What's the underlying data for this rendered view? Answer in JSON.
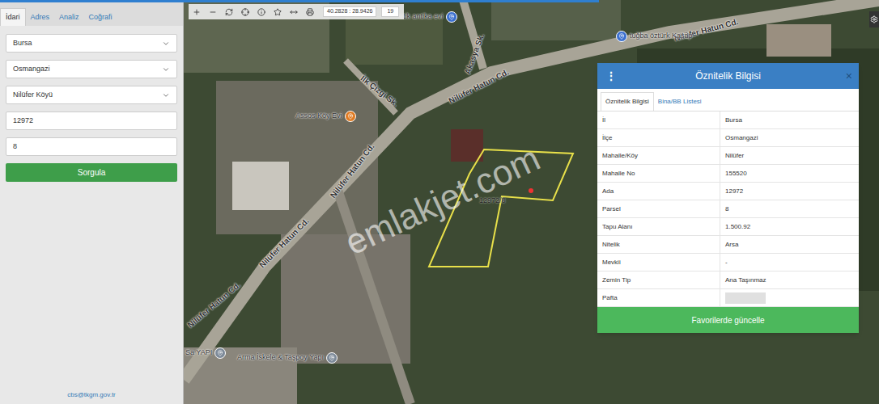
{
  "sidebar": {
    "tabs": [
      {
        "label": "İdari",
        "selected": true
      },
      {
        "label": "Adres",
        "selected": false
      },
      {
        "label": "Analiz",
        "selected": false
      },
      {
        "label": "Coğrafi",
        "selected": false
      }
    ],
    "fields": [
      {
        "kind": "select",
        "value": "Bursa"
      },
      {
        "kind": "select",
        "value": "Osmangazi"
      },
      {
        "kind": "select",
        "value": "Nilüfer Köyü"
      },
      {
        "kind": "input",
        "value": "12972"
      },
      {
        "kind": "input",
        "value": "8"
      }
    ],
    "button": "Sorgula",
    "footer": "cbs@tkgm.gov.tr"
  },
  "toolbar": {
    "coordinates": "40.2828 : 28.9426",
    "zoom": "19"
  },
  "map": {
    "streets": [
      "Nilüfer Hatun Cd.",
      "Nilüfer Hatun Cd.",
      "Nilüfer Hatun Cd.",
      "Nilüfer Hatun Cd.",
      "Nilüfer Hatun Cd.",
      "İlk Çizgi Sk.",
      "Akasya Sk."
    ],
    "places": [
      {
        "name": "ntik antika evi",
        "color": "#3a6fd0"
      },
      {
        "name": "tuğba öztürk Kasap",
        "color": "#3a6fd0"
      },
      {
        "name": "Assos Köy Evi",
        "color": "#e07b22"
      },
      {
        "name": "Arma İskele & Taşpoy Yapı",
        "color": "#7d8a99"
      },
      {
        "name": "Sa YAPI",
        "color": "#7d8a99"
      }
    ],
    "parcel_label": "12972/8",
    "watermark": "emlakjet.com"
  },
  "panel": {
    "title": "Öznitelik Bilgisi",
    "menu": "⋮",
    "close": "×",
    "tabs": [
      {
        "label": "Öznitelik Bilgisi",
        "selected": true
      },
      {
        "label": "Bina/BB Listesi",
        "selected": false
      }
    ],
    "rows": [
      {
        "label": "İl",
        "value": "Bursa",
        "redacted": false
      },
      {
        "label": "İlçe",
        "value": "Osmangazi",
        "redacted": false
      },
      {
        "label": "Mahalle/Köy",
        "value": "Nilüfer",
        "redacted": false
      },
      {
        "label": "Mahalle No",
        "value": "155520",
        "redacted": false
      },
      {
        "label": "Ada",
        "value": "12972",
        "redacted": false
      },
      {
        "label": "Parsel",
        "value": "8",
        "redacted": false
      },
      {
        "label": "Tapu Alanı",
        "value": "1.500.92",
        "redacted": false
      },
      {
        "label": "Nitelik",
        "value": "Arsa",
        "redacted": false
      },
      {
        "label": "Mevkii",
        "value": "-",
        "redacted": false
      },
      {
        "label": "Zemin Tip",
        "value": "Ana Taşınmaz",
        "redacted": false
      },
      {
        "label": "Pafta",
        "value": "",
        "redacted": true
      }
    ],
    "button": "Favorilerde güncelle"
  }
}
